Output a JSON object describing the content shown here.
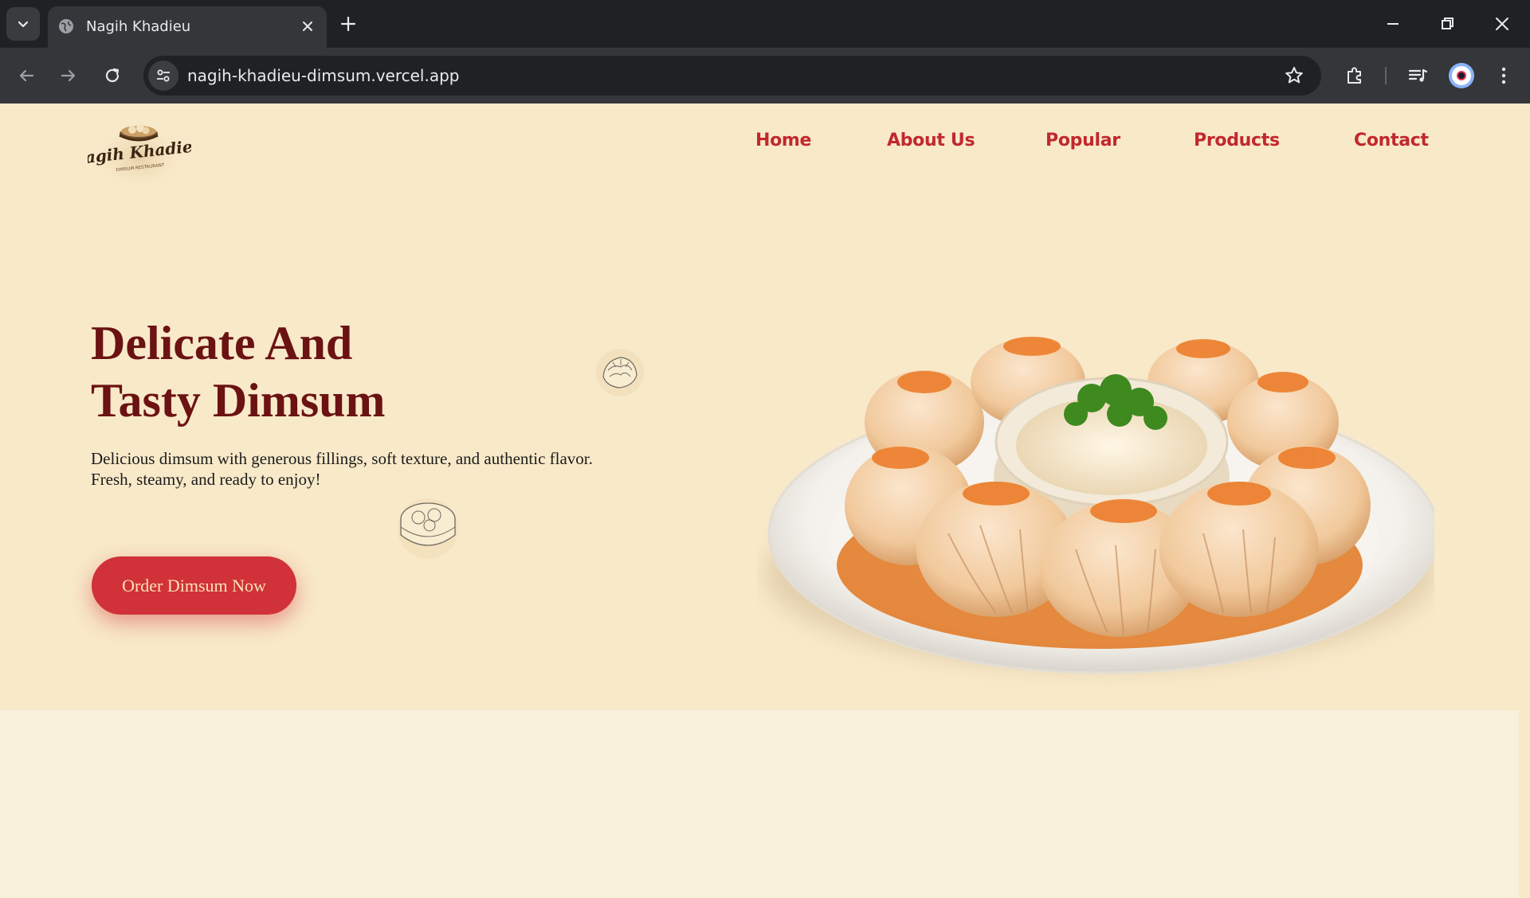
{
  "browser": {
    "tab_title": "Nagih Khadieu",
    "url": "nagih-khadieu-dimsum.vercel.app"
  },
  "site": {
    "logo_text": "Nagih Khadieu",
    "logo_subtext": "DIMSUM RESTAURANT",
    "nav": [
      {
        "label": "Home"
      },
      {
        "label": "About Us"
      },
      {
        "label": "Popular"
      },
      {
        "label": "Products"
      },
      {
        "label": "Contact"
      }
    ]
  },
  "hero": {
    "title_line1": "Delicate And",
    "title_line2": "Tasty Dimsum",
    "description": "Delicious dimsum with generous fillings, soft texture, and authentic flavor. Fresh, steamy, and ready to enjoy!",
    "cta_label": "Order Dimsum Now"
  },
  "colors": {
    "page_bg": "#f8e9c9",
    "accent": "#c1282d",
    "title": "#6b1212",
    "button": "#d13138",
    "button_text": "#fbe3b8"
  }
}
